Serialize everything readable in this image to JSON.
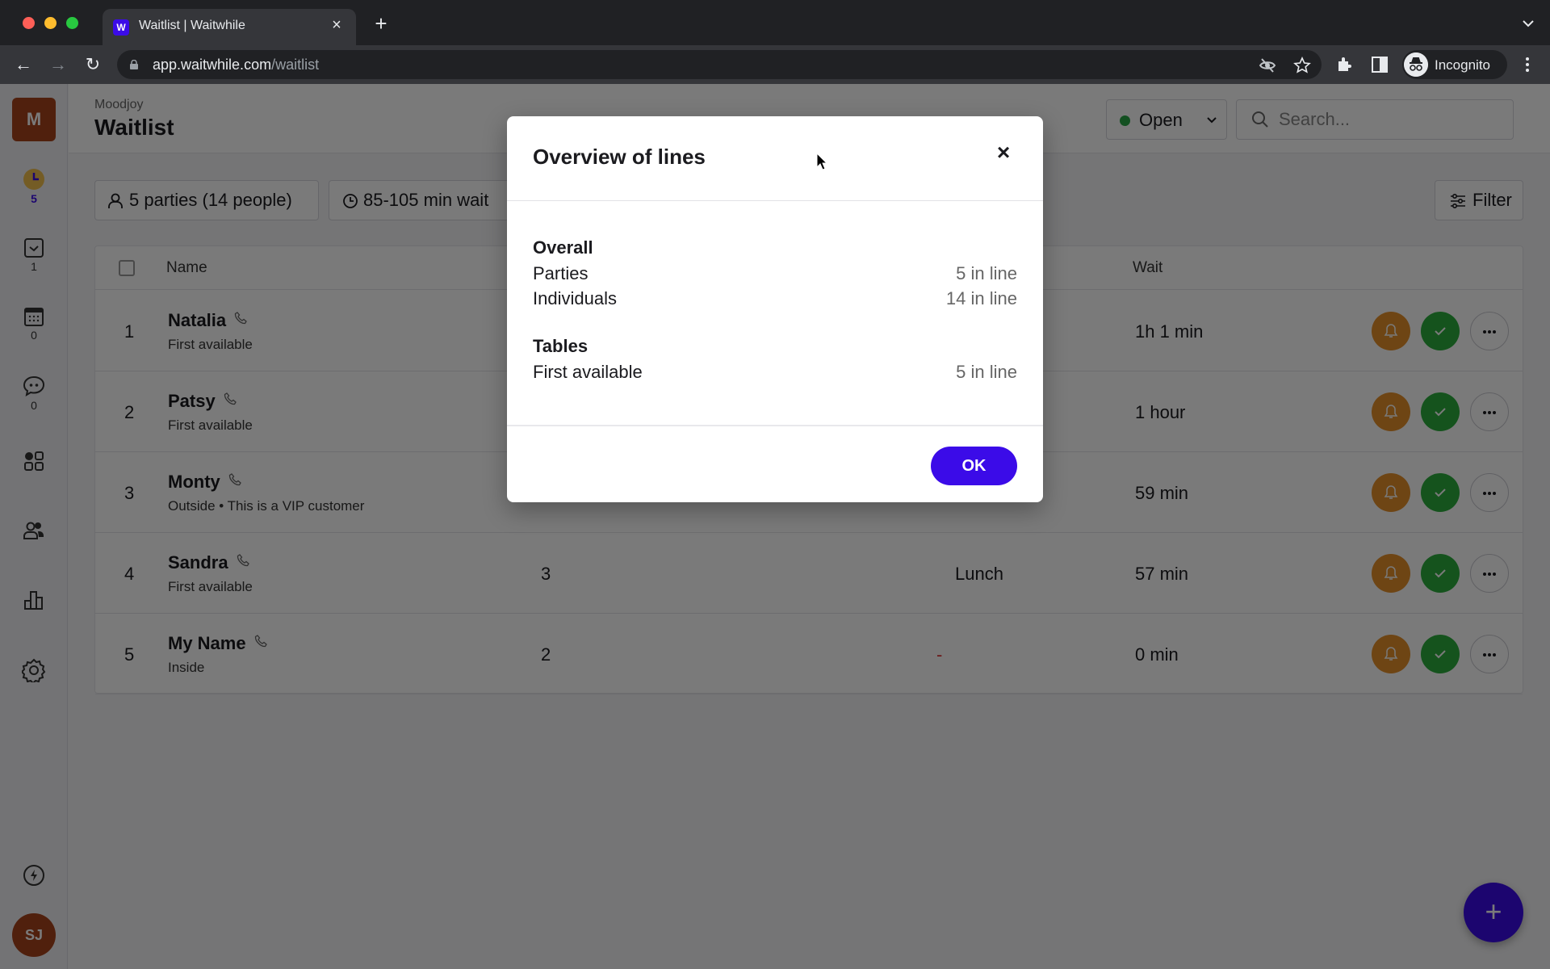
{
  "browser": {
    "tab_title": "Waitlist | Waitwhile",
    "favicon_letter": "W",
    "url_host": "app.waitwhile.com",
    "url_path": "/waitlist",
    "profile_label": "Incognito"
  },
  "sidebar": {
    "org_initial": "M",
    "items": [
      {
        "icon": "clock-icon",
        "count": "5"
      },
      {
        "icon": "checkbox-icon",
        "count": "1"
      },
      {
        "icon": "calendar-icon",
        "count": "0"
      },
      {
        "icon": "chat-icon",
        "count": "0"
      },
      {
        "icon": "apps-grid-icon",
        "count": ""
      },
      {
        "icon": "users-icon",
        "count": ""
      },
      {
        "icon": "bar-chart-icon",
        "count": ""
      },
      {
        "icon": "gear-icon",
        "count": ""
      }
    ],
    "bolt_icon": "lightning-icon",
    "user_initials": "SJ"
  },
  "header": {
    "org_name": "Moodjoy",
    "title": "Waitlist",
    "status_label": "Open",
    "status_color": "#29a745",
    "search_placeholder": "Search..."
  },
  "summary": {
    "parties_chip": "5 parties (14 people)",
    "wait_chip": "85-105 min wait",
    "filter_label": "Filter"
  },
  "table": {
    "columns": {
      "name": "Name",
      "wait": "Wait"
    },
    "rows": [
      {
        "pos": "1",
        "name": "Natalia",
        "sub": "First available",
        "size": "",
        "table": "",
        "wait": "1h 1 min"
      },
      {
        "pos": "2",
        "name": "Patsy",
        "sub": "First available",
        "size": "",
        "table": "",
        "wait": "1 hour"
      },
      {
        "pos": "3",
        "name": "Monty",
        "sub": "Outside  • This is a VIP customer",
        "size": "",
        "table": "",
        "wait": "59 min"
      },
      {
        "pos": "4",
        "name": "Sandra",
        "sub": "First available",
        "size": "3",
        "table": "Lunch",
        "wait": "57 min"
      },
      {
        "pos": "5",
        "name": "My Name",
        "sub": "Inside",
        "size": "2",
        "table": "-",
        "wait": "0 min"
      }
    ]
  },
  "modal": {
    "title": "Overview of lines",
    "close_glyph": "×",
    "sections": [
      {
        "title": "Overall",
        "rows": [
          {
            "label": "Parties",
            "value": "5 in line"
          },
          {
            "label": "Individuals",
            "value": "14 in line"
          }
        ]
      },
      {
        "title": "Tables",
        "rows": [
          {
            "label": "First available",
            "value": "5 in line"
          }
        ]
      }
    ],
    "ok_label": "OK"
  },
  "colors": {
    "brand": "#3b0be8",
    "notify": "#e5902a",
    "serve": "#2cae3d",
    "org_badge": "#a8431c"
  },
  "fab_label": "+"
}
